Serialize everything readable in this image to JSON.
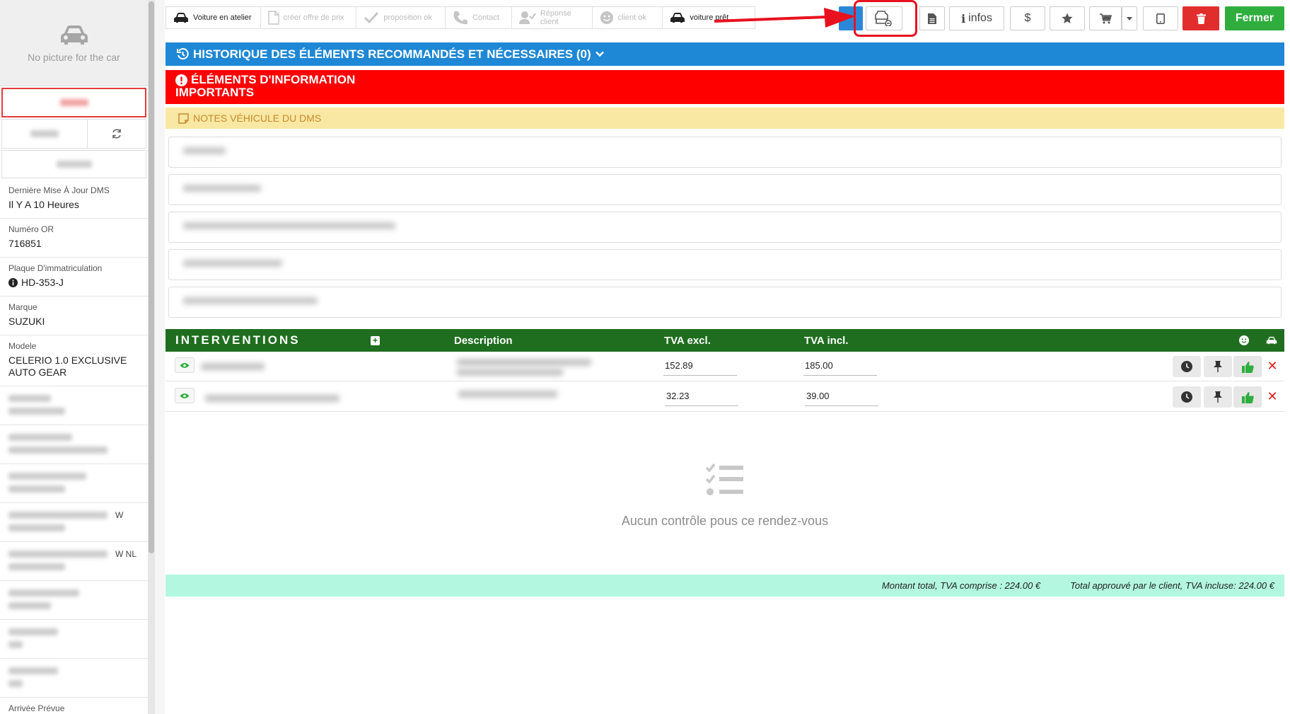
{
  "sidebar": {
    "no_picture_label": "No picture for the car",
    "fields": [
      {
        "key": "Dernière Mise À Jour DMS",
        "value": "Il Y A 10 Heures"
      },
      {
        "key": "Numéro OR",
        "value": "716851"
      },
      {
        "key": "Plaque D'immatriculation",
        "value": "HD-353-J"
      },
      {
        "key": "Marque",
        "value": "SUZUKI"
      },
      {
        "key": "Modele",
        "value": "CELERIO 1.0 EXCLUSIVE AUTO GEAR"
      }
    ],
    "partial_labels": [
      "W",
      "W NL"
    ],
    "bottom_label": "Arrivée Prévue"
  },
  "steps": [
    {
      "label": "Voiture en atelier",
      "icon": "car-icon",
      "active": true
    },
    {
      "label": "créer offre de prix",
      "icon": "document-icon",
      "active": false
    },
    {
      "label": "proposition ok",
      "icon": "check-icon",
      "active": false
    },
    {
      "label": "Contact",
      "icon": "phone-icon",
      "active": false
    },
    {
      "label": "Réponse client",
      "icon": "user-check-icon",
      "active": false
    },
    {
      "label": "client ok",
      "icon": "smile-icon",
      "active": false
    },
    {
      "label": "voiture prêt",
      "icon": "car-icon",
      "active": true
    }
  ],
  "toolbar": {
    "infos_label": "infos",
    "dollar_label": "$",
    "close_label": "Fermer"
  },
  "sections": {
    "history_title": "HISTORIQUE DES ÉLÉMENTS RECOMMANDÉS ET NÉCESSAIRES (0)",
    "important_title_line1": "ÉLÉMENTS D'INFORMATION",
    "important_title_line2": "IMPORTANTS",
    "notes_title": "NOTES VÉHICULE DU DMS"
  },
  "interventions": {
    "title": "INTERVENTIONS",
    "col_description": "Description",
    "col_tva_excl": "TVA excl.",
    "col_tva_incl": "TVA incl.",
    "rows": [
      {
        "tva_excl": "152.89",
        "tva_incl": "185.00"
      },
      {
        "tva_excl": "32.23",
        "tva_incl": "39.00"
      }
    ]
  },
  "empty_state": {
    "message": "Aucun contrôle pous ce rendez-vous"
  },
  "totals": {
    "total_label": "Montant total, TVA comprise : 224.00 €",
    "approved_label": "Total approuvé par le client, TVA incluse: 224.00 €"
  },
  "colors": {
    "history_bar": "#1e88d6",
    "important_bar": "#ff0000",
    "notes_bar": "#f8e8a4",
    "interventions_bar": "#1f6e1f",
    "total_bar": "#b3f7e0",
    "close_button": "#2fae3e",
    "delete_button": "#e22d2d"
  }
}
